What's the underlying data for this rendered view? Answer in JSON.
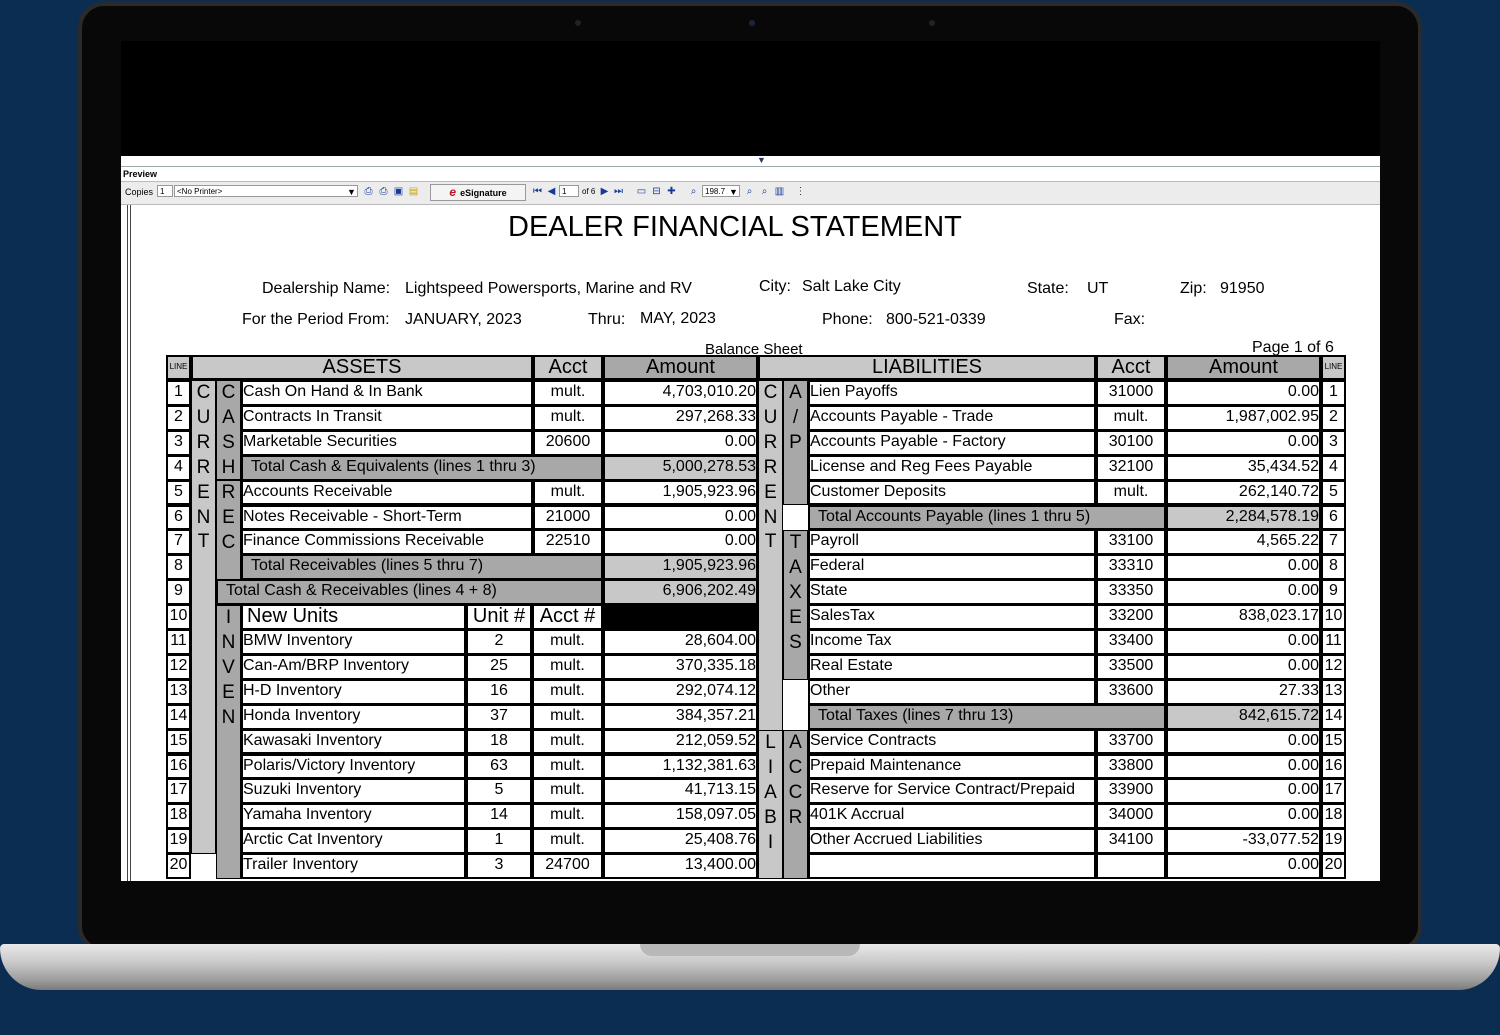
{
  "toolbar": {
    "preview_label": "Preview",
    "copies_label": "Copies",
    "copies_value": "1",
    "printer": "<No Printer>",
    "esignature": "eSignature",
    "page_value": "1",
    "of_pages": "of 6",
    "zoom": "198.7"
  },
  "doc": {
    "title": "DEALER FINANCIAL STATEMENT",
    "dealership_label": "Dealership Name:",
    "dealership_value": "Lightspeed Powersports, Marine and RV",
    "city_label": "City:",
    "city_value": "Salt Lake City",
    "state_label": "State:",
    "state_value": "UT",
    "zip_label": "Zip:",
    "zip_value": "91950",
    "period_label": "For the Period From:",
    "period_from": "JANUARY, 2023",
    "thru_label": "Thru:",
    "thru_value": "MAY, 2023",
    "phone_label": "Phone:",
    "phone_value": "800-521-0339",
    "fax_label": "Fax:",
    "section": "Balance Sheet",
    "page_indicator": "Page 1 of 6"
  },
  "headers": {
    "line": "LINE",
    "assets": "ASSETS",
    "acct": "Acct",
    "amount": "Amount",
    "liabilities": "LIABILITIES",
    "new_units": "New Units",
    "unit_no": "Unit #",
    "acct_no": "Acct #"
  },
  "group_labels": {
    "cash": "C\nA\nS\nH",
    "rec": "R\nE\nC",
    "current_left": "C\nU\nR\nR\nE\nN\nT",
    "inven": "I\nN\nV\nE\nN",
    "ap": "A\n/\nP",
    "current_right": "C\nU\nR\nR\nE\nN\nT",
    "taxes": "T\nA\nX\nE\nS",
    "liab": "L\nI\nA\nB\nI",
    "accr": "A\nC\nC\nR"
  },
  "assets": {
    "r1": {
      "line": "1",
      "name": "Cash On Hand & In Bank",
      "acct": "mult.",
      "amount": "4,703,010.20"
    },
    "r2": {
      "line": "2",
      "name": "Contracts In Transit",
      "acct": "mult.",
      "amount": "297,268.33"
    },
    "r3": {
      "line": "3",
      "name": "Marketable Securities",
      "acct": "20600",
      "amount": "0.00"
    },
    "r4": {
      "line": "4",
      "name": "Total Cash & Equivalents (lines 1 thru 3)",
      "amount": "5,000,278.53"
    },
    "r5": {
      "line": "5",
      "name": "Accounts Receivable",
      "acct": "mult.",
      "amount": "1,905,923.96"
    },
    "r6": {
      "line": "6",
      "name": "Notes Receivable - Short-Term",
      "acct": "21000",
      "amount": "0.00"
    },
    "r7": {
      "line": "7",
      "name": "Finance Commissions Receivable",
      "acct": "22510",
      "amount": "0.00"
    },
    "r8": {
      "line": "8",
      "name": "Total Receivables (lines 5 thru 7)",
      "amount": "1,905,923.96"
    },
    "r9": {
      "line": "9",
      "name": "Total Cash & Receivables (lines 4 + 8)",
      "amount": "6,906,202.49"
    },
    "r10": {
      "line": "10"
    },
    "r11": {
      "line": "11",
      "name": "BMW Inventory",
      "unit": "2",
      "acct": "mult.",
      "amount": "28,604.00"
    },
    "r12": {
      "line": "12",
      "name": "Can-Am/BRP Inventory",
      "unit": "25",
      "acct": "mult.",
      "amount": "370,335.18"
    },
    "r13": {
      "line": "13",
      "name": "H-D Inventory",
      "unit": "16",
      "acct": "mult.",
      "amount": "292,074.12"
    },
    "r14": {
      "line": "14",
      "name": "Honda Inventory",
      "unit": "37",
      "acct": "mult.",
      "amount": "384,357.21"
    },
    "r15": {
      "line": "15",
      "name": "Kawasaki Inventory",
      "unit": "18",
      "acct": "mult.",
      "amount": "212,059.52"
    },
    "r16": {
      "line": "16",
      "name": "Polaris/Victory Inventory",
      "unit": "63",
      "acct": "mult.",
      "amount": "1,132,381.63"
    },
    "r17": {
      "line": "17",
      "name": "Suzuki Inventory",
      "unit": "5",
      "acct": "mult.",
      "amount": "41,713.15"
    },
    "r18": {
      "line": "18",
      "name": "Yamaha Inventory",
      "unit": "14",
      "acct": "mult.",
      "amount": "158,097.05"
    },
    "r19": {
      "line": "19",
      "name": "Arctic Cat Inventory",
      "unit": "1",
      "acct": "mult.",
      "amount": "25,408.76"
    },
    "r20": {
      "line": "20",
      "name": "Trailer Inventory",
      "unit": "3",
      "acct": "24700",
      "amount": "13,400.00"
    }
  },
  "liabilities": {
    "r1": {
      "line": "1",
      "name": "Lien Payoffs",
      "acct": "31000",
      "amount": "0.00"
    },
    "r2": {
      "line": "2",
      "name": "Accounts Payable - Trade",
      "acct": "mult.",
      "amount": "1,987,002.95"
    },
    "r3": {
      "line": "3",
      "name": "Accounts Payable - Factory",
      "acct": "30100",
      "amount": "0.00"
    },
    "r4": {
      "line": "4",
      "name": "License and Reg Fees Payable",
      "acct": "32100",
      "amount": "35,434.52"
    },
    "r5": {
      "line": "5",
      "name": "Customer Deposits",
      "acct": "mult.",
      "amount": "262,140.72"
    },
    "r6": {
      "line": "6",
      "name": "Total Accounts Payable (lines 1 thru 5)",
      "amount": "2,284,578.19"
    },
    "r7": {
      "line": "7",
      "name": "Payroll",
      "acct": "33100",
      "amount": "4,565.22"
    },
    "r8": {
      "line": "8",
      "name": "Federal",
      "acct": "33310",
      "amount": "0.00"
    },
    "r9": {
      "line": "9",
      "name": "State",
      "acct": "33350",
      "amount": "0.00"
    },
    "r10": {
      "line": "10",
      "name": "SalesTax",
      "acct": "33200",
      "amount": "838,023.17"
    },
    "r11": {
      "line": "11",
      "name": "Income Tax",
      "acct": "33400",
      "amount": "0.00"
    },
    "r12": {
      "line": "12",
      "name": "Real Estate",
      "acct": "33500",
      "amount": "0.00"
    },
    "r13": {
      "line": "13",
      "name": "Other",
      "acct": "33600",
      "amount": "27.33"
    },
    "r14": {
      "line": "14",
      "name": "Total Taxes (lines 7 thru 13)",
      "amount": "842,615.72"
    },
    "r15": {
      "line": "15",
      "name": "Service Contracts",
      "acct": "33700",
      "amount": "0.00"
    },
    "r16": {
      "line": "16",
      "name": "Prepaid Maintenance",
      "acct": "33800",
      "amount": "0.00"
    },
    "r17": {
      "line": "17",
      "name": "Reserve for Service Contract/Prepaid",
      "acct": "33900",
      "amount": "0.00"
    },
    "r18": {
      "line": "18",
      "name": "401K Accrual",
      "acct": "34000",
      "amount": "0.00"
    },
    "r19": {
      "line": "19",
      "name": "Other Accrued Liabilities",
      "acct": "34100",
      "amount": "-33,077.52"
    },
    "r20": {
      "line": "20",
      "name": "",
      "acct": "",
      "amount": "0.00"
    }
  }
}
